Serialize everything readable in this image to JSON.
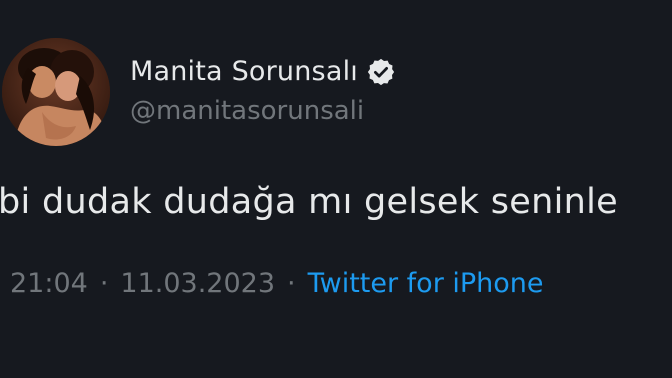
{
  "tweet": {
    "display_name": "Manita Sorunsalı",
    "handle": "@manitasorunsali",
    "verified_icon": "verified-badge-icon",
    "text": "bi dudak dudağa mı gelsek seninle",
    "time": "21:04",
    "separator": "·",
    "date": "11.03.2023",
    "source": "Twitter for iPhone"
  },
  "colors": {
    "background": "#16191f",
    "text_primary": "#e7e9ea",
    "text_secondary": "#71767b",
    "link": "#1d9bf0"
  }
}
